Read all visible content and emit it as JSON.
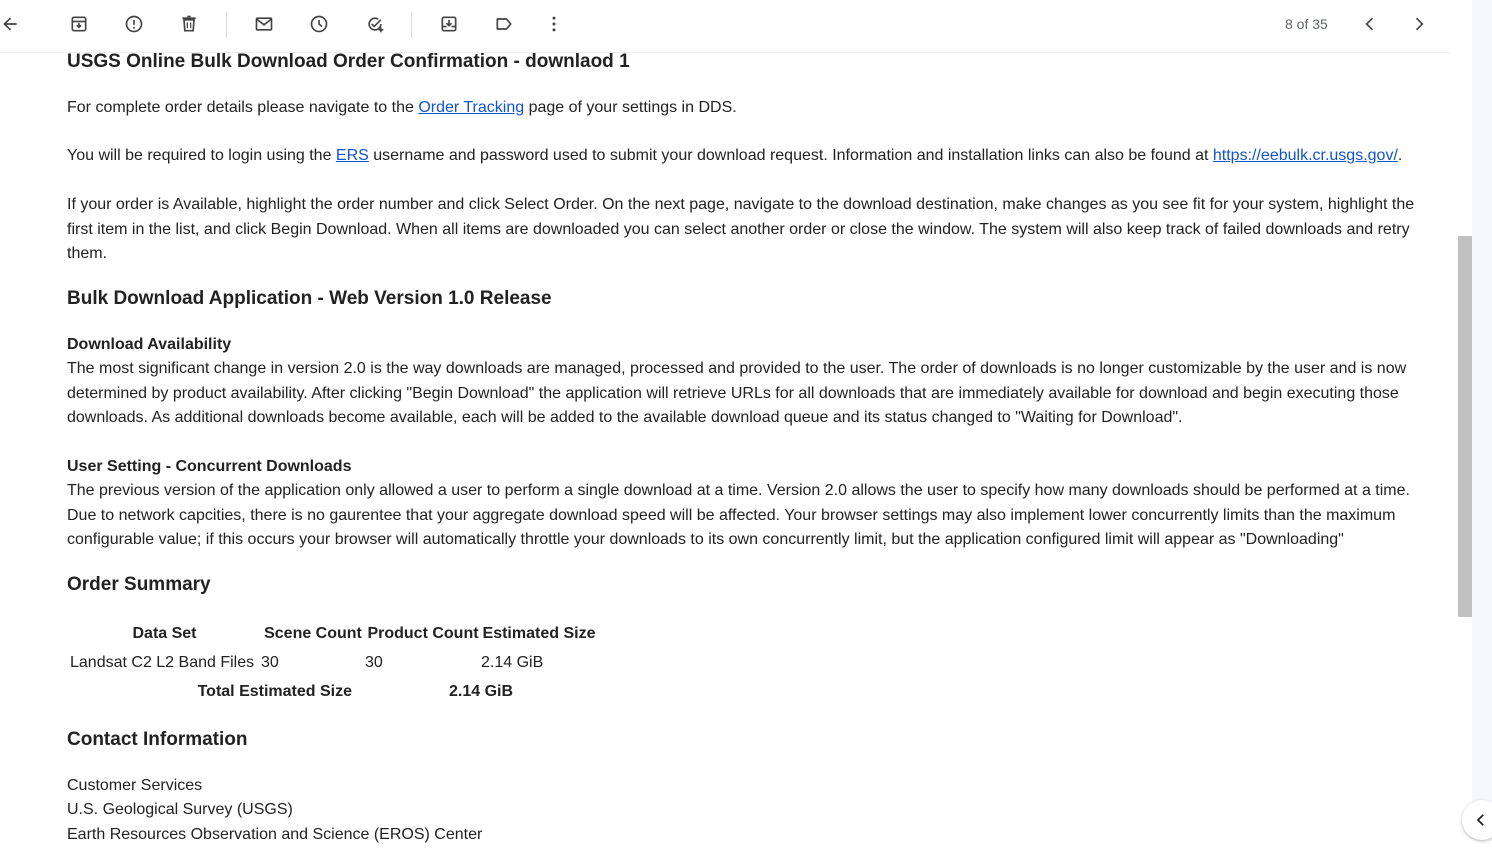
{
  "toolbar": {
    "icons": [
      "back-arrow-icon",
      "archive-icon",
      "report-spam-icon",
      "delete-icon",
      "mark-unread-icon",
      "snooze-icon",
      "add-to-tasks-icon",
      "move-to-icon",
      "labels-icon",
      "more-icon",
      "older-icon",
      "newer-icon"
    ],
    "pager": "8 of 35"
  },
  "email": {
    "title": "USGS Online Bulk Download Order Confirmation - downlaod 1",
    "p1_before": "For complete order details please navigate to the ",
    "p1_link": "Order Tracking",
    "p1_after": " page of your settings in DDS.",
    "p2_before": "You will be required to login using the ",
    "p2_link1": "ERS",
    "p2_middle": " username and password used to submit your download request. Information and installation links can also be found at ",
    "p2_link2": "https://eebulk.cr.usgs.gov/",
    "p2_after": ".",
    "p3": "If your order is Available, highlight the order number and click Select Order. On the next page, navigate to the download destination, make changes as you see fit for your system, highlight the first item in the list, and click Begin Download. When all items are downloaded you can select another order or close the window. The system will also keep track of failed downloads and retry them.",
    "h_bulk": "Bulk Download Application - Web Version 1.0 Release",
    "h_avail": "Download Availability",
    "p_avail": "The most significant change in version 2.0 is the way downloads are managed, processed and provided to the user. The order of downloads is no longer customizable by the user and is now determined by product availability. After clicking \"Begin Download\" the application will retrieve URLs for all downloads that are immediately available for download and begin executing those downloads. As additional downloads become available, each will be added to the available download queue and its status changed to \"Waiting for Download\".",
    "h_concurrent": "User Setting - Concurrent Downloads",
    "p_concurrent": "The previous version of the application only allowed a user to perform a single download at a time. Version 2.0 allows the user to specify how many downloads should be performed at a time. Due to network capcities, there is no gaurentee that your aggregate download speed will be affected. Your browser settings may also implement lower concurrently limits than the maximum configurable value; if this occurs your browser will automatically throttle your downloads to its own concurrently limit, but the application configured limit will appear as \"Downloading\"",
    "h_summary": "Order Summary",
    "table": {
      "headers": [
        "Data Set",
        "Scene Count",
        "Product Count",
        "Estimated Size"
      ],
      "rows": [
        [
          "Landsat C2 L2 Band Files",
          "30",
          "30",
          "2.14 GiB"
        ]
      ],
      "total_label": "Total Estimated Size",
      "total_value": "2.14 GiB"
    },
    "h_contact": "Contact Information",
    "contact": [
      "Customer Services",
      "U.S. Geological Survey (USGS)",
      "Earth Resources Observation and Science (EROS) Center"
    ]
  }
}
